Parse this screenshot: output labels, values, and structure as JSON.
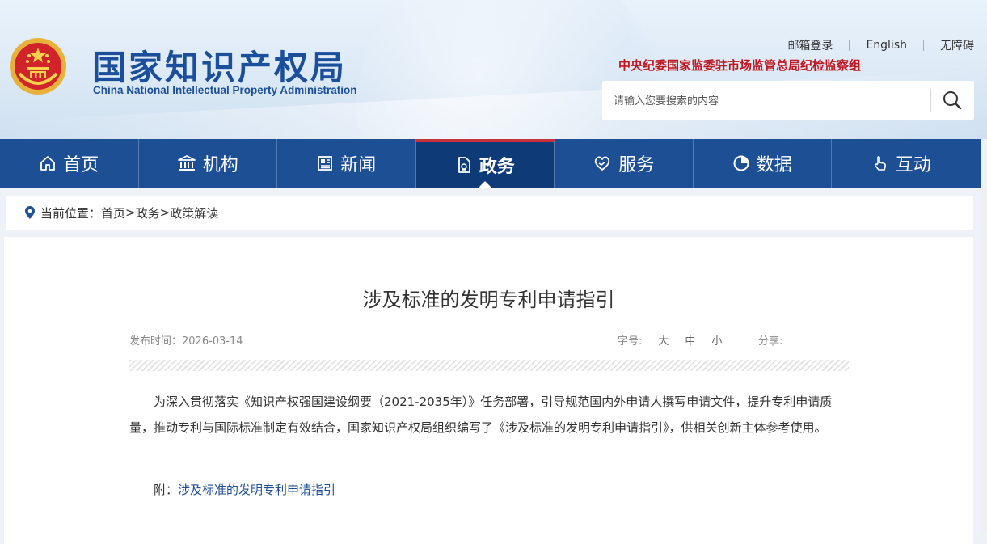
{
  "header": {
    "org_cn": "国家知识产权局",
    "org_en": "China National Intellectual Property Administration",
    "top_links": [
      "邮箱登录",
      "English",
      "无障碍"
    ],
    "supervision": "中央纪委国家监委驻市场监管总局纪检监察组",
    "search_placeholder": "请输入您要搜索的内容",
    "search_icon": "search-icon"
  },
  "nav": {
    "items": [
      {
        "label": "首页",
        "icon": "home-icon"
      },
      {
        "label": "机构",
        "icon": "institution-icon"
      },
      {
        "label": "新闻",
        "icon": "news-icon"
      },
      {
        "label": "政务",
        "icon": "government-affairs-icon",
        "active": true
      },
      {
        "label": "服务",
        "icon": "service-heart-icon"
      },
      {
        "label": "数据",
        "icon": "pie-chart-icon"
      },
      {
        "label": "互动",
        "icon": "hand-pointer-icon"
      }
    ]
  },
  "breadcrumb": {
    "prefix": "当前位置：",
    "items": [
      "首页",
      "政务",
      "政策解读"
    ],
    "separator": ">"
  },
  "article": {
    "title": "涉及标准的发明专利申请指引",
    "date_label": "发布时间：2026-03-14",
    "font_size_label": "字号:",
    "font_sizes": [
      "大",
      "中",
      "小"
    ],
    "share_label": "分享:",
    "paragraph": "为深入贯彻落实《知识产权强国建设纲要（2021-2035年）》任务部署，引导规范国内外申请人撰写申请文件，提升专利申请质量，推动专利与国际标准制定有效结合，国家知识产权局组织编写了《涉及标准的发明专利申请指引》，供相关创新主体参考使用。",
    "attachment_prefix": "附：",
    "attachment_link": "涉及标准的发明专利申请指引"
  },
  "colors": {
    "brand_blue": "#1d4f95",
    "active_nav": "#0f3a78",
    "accent_red": "#c9323a",
    "supervision_red": "#c0161d"
  }
}
